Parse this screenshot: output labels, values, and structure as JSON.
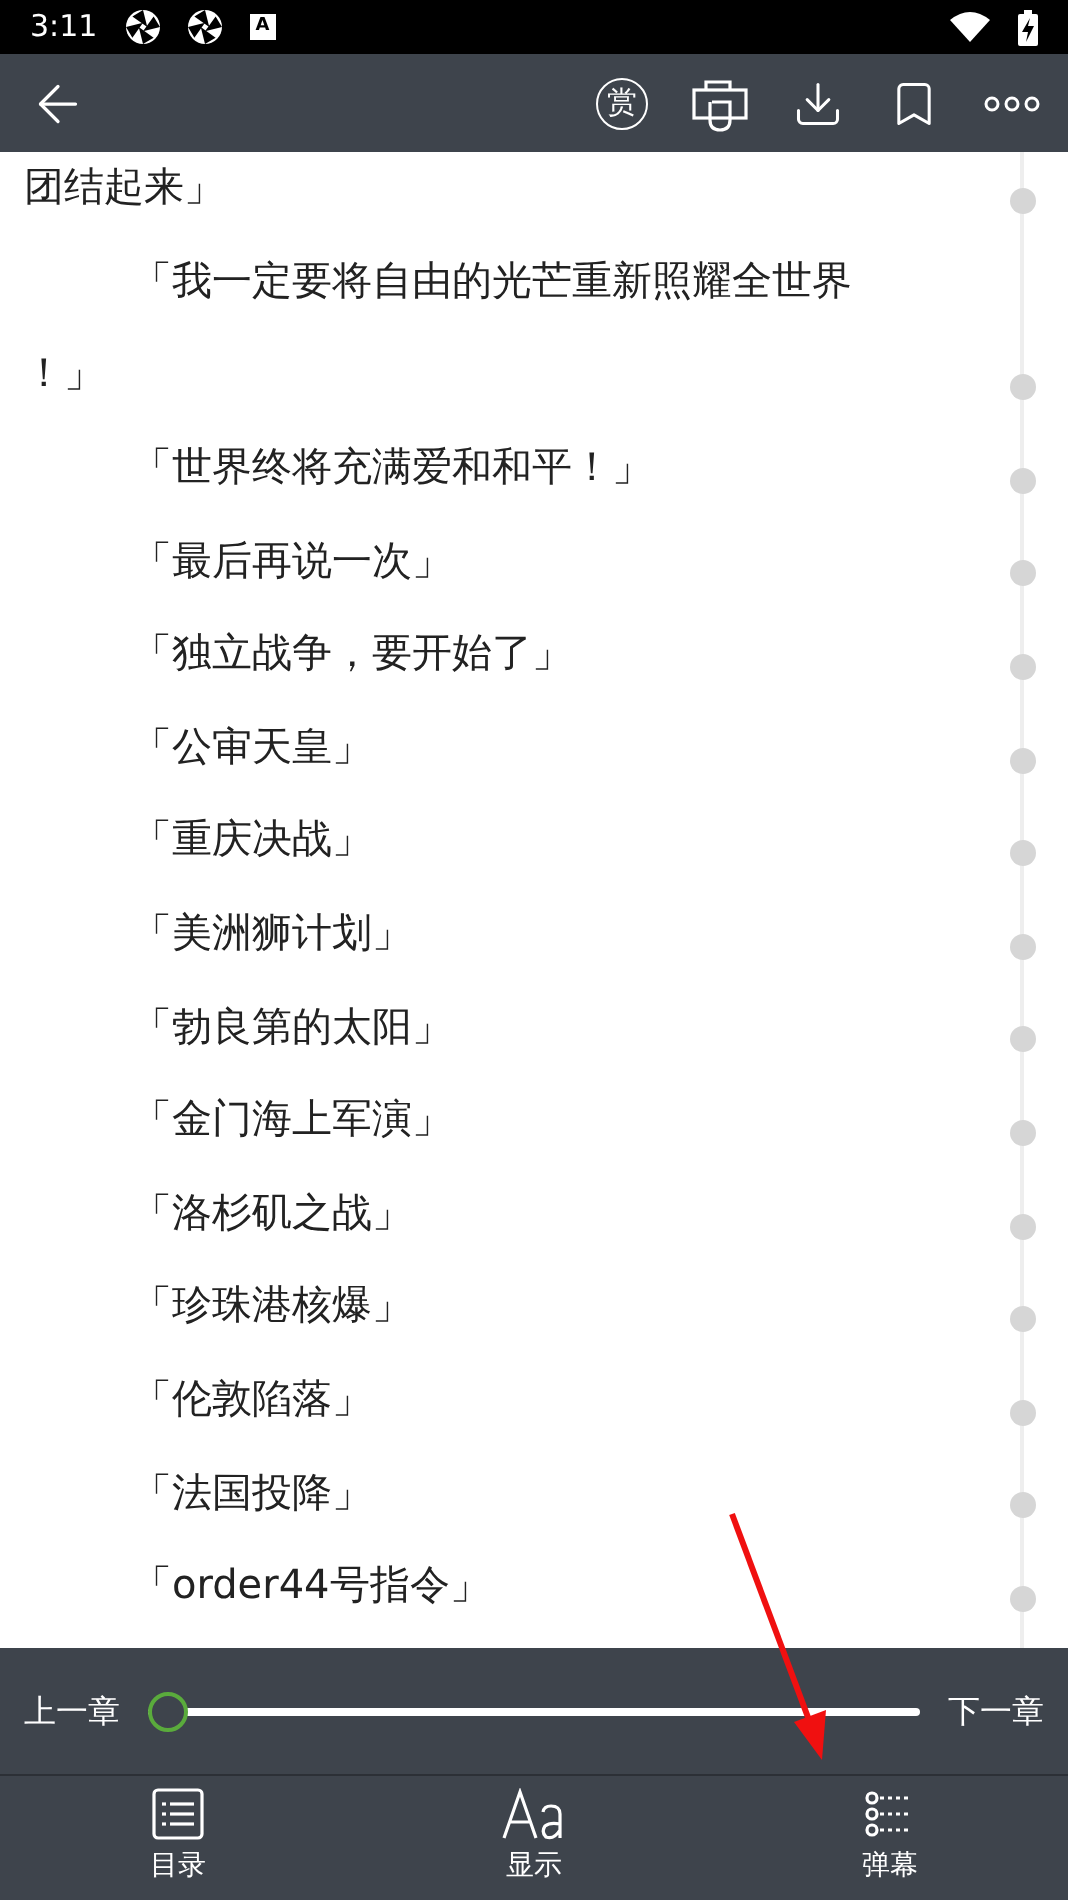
{
  "status_bar": {
    "time": "3:11",
    "badge_letter": "A"
  },
  "top_bar": {
    "reward_label": "赏"
  },
  "lines": [
    {
      "text": "团结起来」",
      "indent": false,
      "marker": true
    },
    {
      "text": "「我一定要将自由的光芒重新照耀全世界",
      "indent": true,
      "marker": false
    },
    {
      "text": "！」",
      "indent": false,
      "marker": true
    },
    {
      "text": "「世界终将充满爱和和平！」",
      "indent": true,
      "marker": true
    },
    {
      "text": "「最后再说一次」",
      "indent": true,
      "marker": true
    },
    {
      "text": "「独立战争，要开始了」",
      "indent": true,
      "marker": true
    },
    {
      "text": "「公审天皇」",
      "indent": true,
      "marker": true
    },
    {
      "text": "「重庆决战」",
      "indent": true,
      "marker": true
    },
    {
      "text": "「美洲狮计划」",
      "indent": true,
      "marker": true
    },
    {
      "text": "「勃良第的太阳」",
      "indent": true,
      "marker": true
    },
    {
      "text": "「金门海上军演」",
      "indent": true,
      "marker": true
    },
    {
      "text": "「洛杉矶之战」",
      "indent": true,
      "marker": true
    },
    {
      "text": "「珍珠港核爆」",
      "indent": true,
      "marker": true
    },
    {
      "text": "「伦敦陷落」",
      "indent": true,
      "marker": true
    },
    {
      "text": "「法国投降」",
      "indent": true,
      "marker": true
    },
    {
      "text": "「order44号指令」",
      "indent": true,
      "marker": true
    }
  ],
  "chapter_bar": {
    "prev": "上一章",
    "next": "下一章",
    "level": 0
  },
  "bottom_nav": [
    {
      "kind": "list",
      "label": "目录"
    },
    {
      "kind": "font",
      "label": "显示"
    },
    {
      "kind": "danmaku",
      "label": "弹幕"
    }
  ]
}
